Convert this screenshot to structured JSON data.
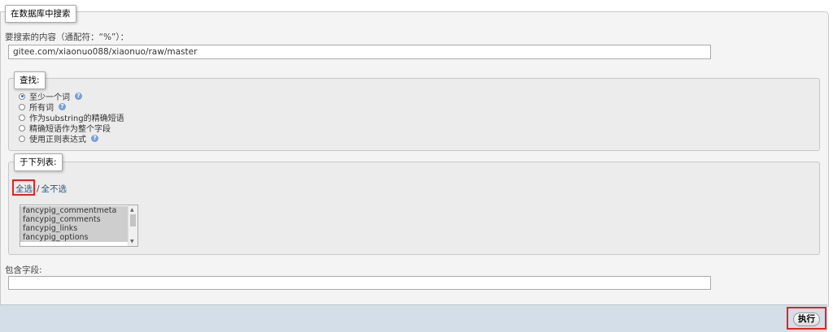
{
  "search_panel": {
    "legend": "在数据库中搜索",
    "search_label": "要搜索的内容（通配符：“%”）：",
    "search_value": "gitee.com/xiaonuo088/xiaonuo/raw/master",
    "find": {
      "legend": "查找:",
      "options": [
        {
          "label": "至少一个词",
          "selected": true,
          "help": true
        },
        {
          "label": "所有词",
          "selected": false,
          "help": true
        },
        {
          "label": "作为substring的精确短语",
          "selected": false,
          "help": false
        },
        {
          "label": "精确短语作为整个字段",
          "selected": false,
          "help": false
        },
        {
          "label": "使用正则表达式",
          "selected": false,
          "help": true
        }
      ]
    },
    "tables": {
      "legend": "于下列表:",
      "select_all": "全选",
      "separator": "/",
      "deselect_all": "全不选",
      "items": [
        "fancypig_commentmeta",
        "fancypig_comments",
        "fancypig_links",
        "fancypig_options"
      ]
    },
    "field_label": "包含字段:",
    "field_value": ""
  },
  "footer": {
    "go_button": "执行"
  },
  "colors": {
    "accent_red": "#e8201c",
    "link": "#235a81",
    "footer_bg": "#d4dee8"
  }
}
